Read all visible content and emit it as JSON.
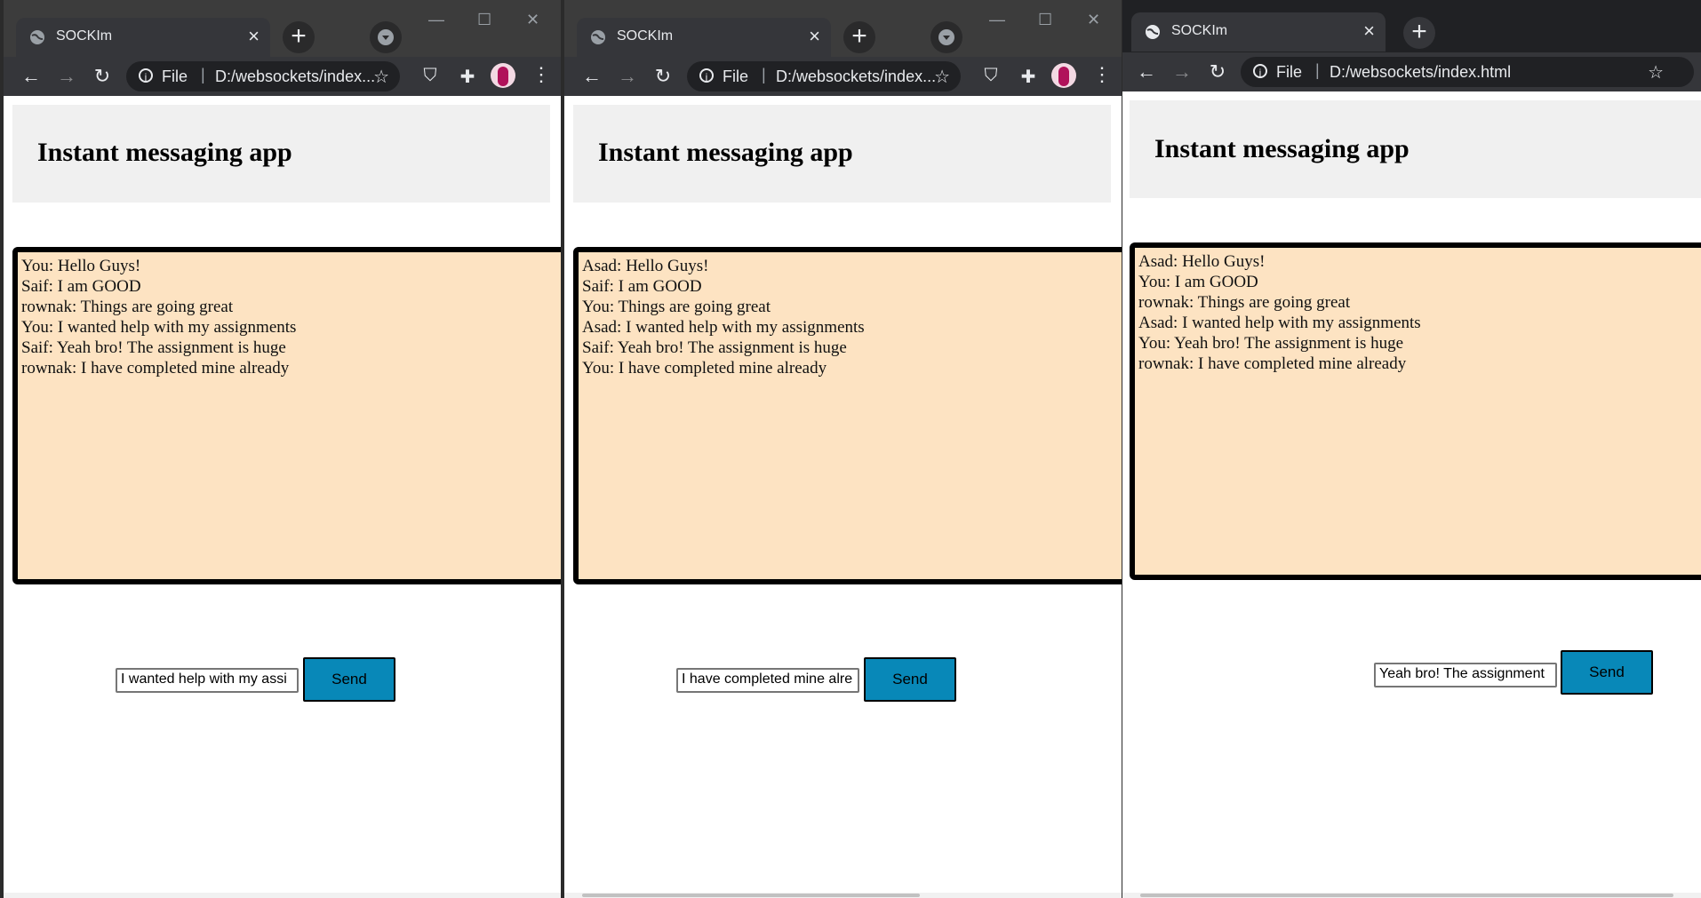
{
  "windows": [
    {
      "tab_title": "SOCKIm",
      "omnibox": {
        "scheme": "File",
        "url": "D:/websockets/index..."
      },
      "page": {
        "title": "Instant messaging app",
        "messages": [
          "You: Hello Guys!",
          "Saif: I am GOOD",
          "rownak: Things are going great",
          "You: I wanted help with my assignments",
          "Saif: Yeah bro! The assignment is huge",
          "rownak: I have completed mine already"
        ],
        "input_value": "I wanted help with my assi",
        "send_label": "Send"
      }
    },
    {
      "tab_title": "SOCKIm",
      "omnibox": {
        "scheme": "File",
        "url": "D:/websockets/index..."
      },
      "page": {
        "title": "Instant messaging app",
        "messages": [
          "Asad: Hello Guys!",
          "Saif: I am GOOD",
          "You: Things are going great",
          "Asad: I wanted help with my assignments",
          "Saif: Yeah bro! The assignment is huge",
          "You: I have completed mine already"
        ],
        "input_value": "I have completed mine alre",
        "send_label": "Send"
      }
    },
    {
      "tab_title": "SOCKIm",
      "omnibox": {
        "scheme": "File",
        "url": "D:/websockets/index.html"
      },
      "page": {
        "title": "Instant messaging app",
        "messages": [
          "Asad: Hello Guys!",
          "You: I am GOOD",
          "rownak: Things are going great",
          "Asad: I wanted help with my assignments",
          "You: Yeah bro! The assignment is huge",
          "rownak: I have completed mine already"
        ],
        "input_value": "Yeah bro! The assignment",
        "send_label": "Send"
      }
    }
  ],
  "icons": {
    "close": "×",
    "new_tab": "+",
    "back": "←",
    "forward": "→",
    "reload": "↻",
    "star": "☆",
    "menu": "⋮",
    "minimize": "—",
    "maximize": "☐",
    "window_close": "✕"
  }
}
